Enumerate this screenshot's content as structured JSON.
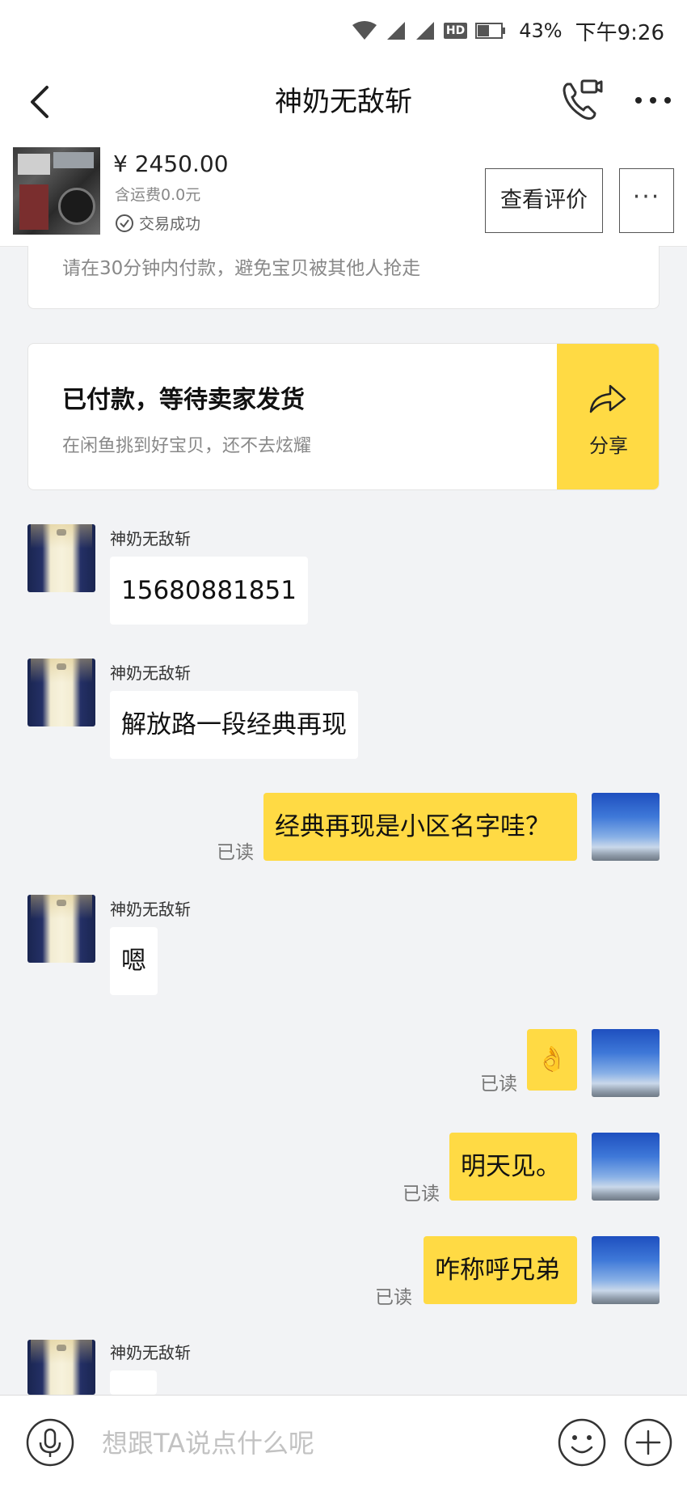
{
  "status_bar": {
    "hd_label": "HD",
    "battery": "43%",
    "time": "下午9:26"
  },
  "nav": {
    "title": "神奶无敌斩"
  },
  "product": {
    "price": "¥ 2450.00",
    "shipping": "含运费0.0元",
    "status": "交易成功",
    "review_label": "查看评价",
    "more_label": "···"
  },
  "notice": {
    "text": "请在30分钟内付款，避免宝贝被其他人抢走"
  },
  "order_status": {
    "title": "已付款，等待卖家发货",
    "subtitle": "在闲鱼挑到好宝贝，还不去炫耀",
    "share_label": "分享"
  },
  "messages": [
    {
      "sender": "神奶无敌斩",
      "text": "15680881851"
    },
    {
      "sender": "神奶无敌斩",
      "text": "解放路一段经典再现"
    },
    {
      "text": "经典再现是小区名字哇？",
      "read": "已读"
    },
    {
      "sender": "神奶无敌斩",
      "text": "嗯"
    },
    {
      "text": "👌",
      "read": "已读"
    },
    {
      "text": "明天见。",
      "read": "已读"
    },
    {
      "text": "咋称呼兄弟",
      "read": "已读"
    },
    {
      "sender": "神奶无敌斩",
      "text": ""
    }
  ],
  "input": {
    "placeholder": "想跟TA说点什么呢"
  },
  "colors": {
    "accent_yellow": "#ffda44",
    "background": "#f2f3f5"
  },
  "icons": [
    "back-icon",
    "phone-call-icon",
    "more-icon",
    "share-icon",
    "check-circle-icon",
    "mic-icon",
    "emoji-icon",
    "plus-icon",
    "wifi-icon",
    "signal-icon",
    "battery-icon"
  ]
}
